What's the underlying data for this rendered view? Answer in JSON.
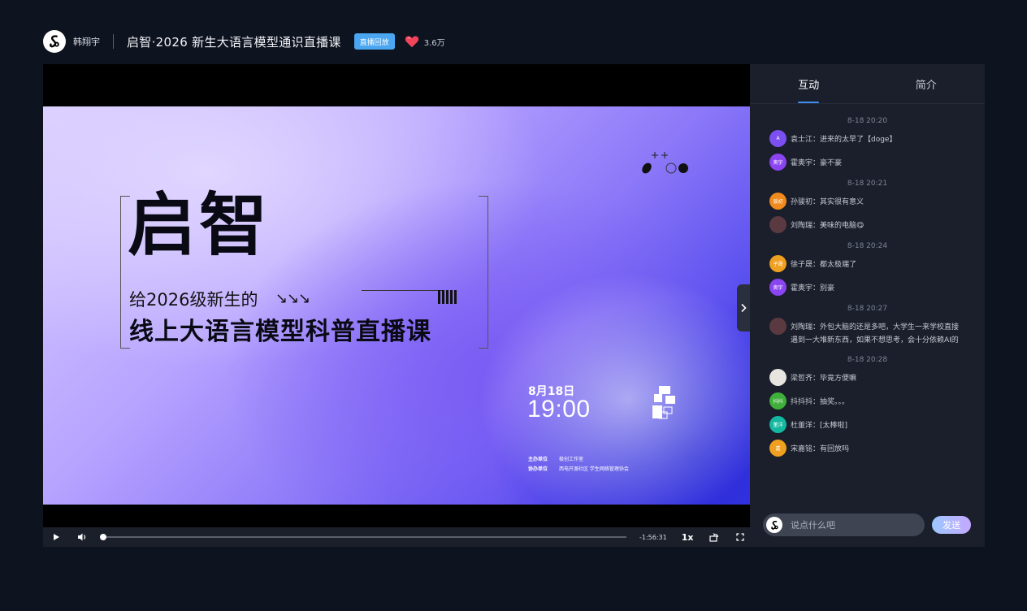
{
  "header": {
    "author": "韩翔宇",
    "title": "启智·2026 新生大语言模型通识直播课",
    "badge": "直播回放",
    "likes": "3.6万"
  },
  "poster": {
    "title": "启智",
    "subtitle1": "给2026级新生的",
    "subtitle1_arrows": "↘↘↘",
    "subtitle2": "线上大语言模型科普直播课",
    "date": "8月18日",
    "time": "19:00",
    "organizer_label": "主办单位",
    "co_organizer_label": "协办单位",
    "organizer": "极创工作室",
    "co_organizer": "西电开源社区   学生网络管理协会"
  },
  "controls": {
    "remaining": "-1:56:31",
    "speed": "1x",
    "progress": 0.0
  },
  "panel": {
    "tabs": [
      {
        "label": "互动",
        "active": true
      },
      {
        "label": "简介",
        "active": false
      }
    ],
    "chat": [
      {
        "type": "time",
        "text": "8-18 20:20"
      },
      {
        "type": "msg",
        "avatar": "A",
        "avatar_color": "#7b4ff0",
        "text": "袁士江：进来的太早了【doge】"
      },
      {
        "type": "msg",
        "avatar": "奥宇",
        "avatar_color": "#8a44f0",
        "text": "霍奥宇：豪不豪"
      },
      {
        "type": "time",
        "text": "8-18 20:21"
      },
      {
        "type": "msg",
        "avatar": "骏初",
        "avatar_color": "#f08a1c",
        "text": "孙骏初：其实很有意义"
      },
      {
        "type": "msg",
        "avatar": "",
        "avatar_color": "#5a3a40",
        "text": "刘陶瑞：美味的电脑😋"
      },
      {
        "type": "time",
        "text": "8-18 20:24"
      },
      {
        "type": "msg",
        "avatar": "子晟",
        "avatar_color": "#f0a020",
        "text": "徐子晟：都太极端了"
      },
      {
        "type": "msg",
        "avatar": "奥宇",
        "avatar_color": "#8a44f0",
        "text": "霍奥宇：别豪"
      },
      {
        "type": "time",
        "text": "8-18 20:27"
      },
      {
        "type": "msg",
        "avatar": "",
        "avatar_color": "#5a3a40",
        "text": "刘陶瑞：外包大脑的还是多吧，大学生一来学校直接遇到一大堆新东西，如果不想思考，会十分依赖AI的"
      },
      {
        "type": "time",
        "text": "8-18 20:28"
      },
      {
        "type": "msg",
        "avatar": "",
        "avatar_color": "#e8e4df",
        "text": "梁哲齐：毕竟方便嘛"
      },
      {
        "type": "msg",
        "avatar": "抖抖",
        "avatar_color": "#3fae3a",
        "text": "抖抖抖：抽奖。。。"
      },
      {
        "type": "msg",
        "avatar": "董洋",
        "avatar_color": "#14b8a0",
        "text": "杜董洋：[太棒啦]"
      },
      {
        "type": "msg",
        "avatar": "嘉",
        "avatar_color": "#f0a020",
        "text": "宋嘉铭：有回放吗"
      }
    ],
    "input_placeholder": "说点什么吧",
    "send_label": "发送"
  },
  "colors": {
    "accent": "#3d8ef0",
    "badge": "#4aa6f0",
    "heart": "#f0445a",
    "background": "#0e1320",
    "panel": "#1a1f2b"
  }
}
